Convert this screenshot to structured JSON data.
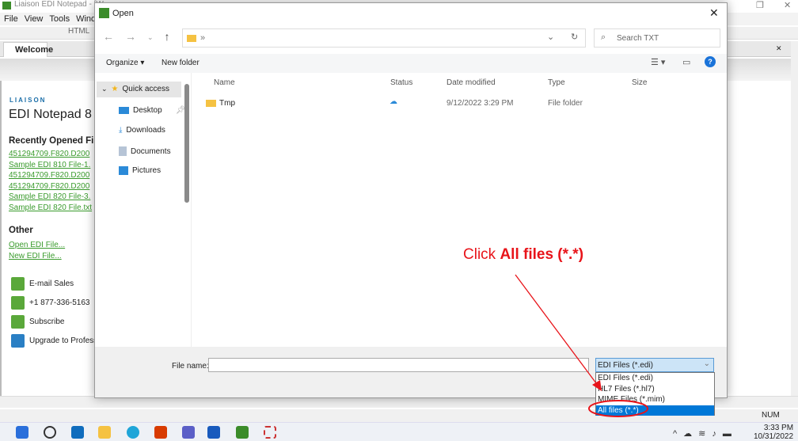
{
  "app": {
    "title": "Liaison EDI Notepad - [W...",
    "menu": [
      "File",
      "View",
      "Tools",
      "Window"
    ],
    "toolbar_mode": "HTML",
    "tab": "Welcome",
    "brand": "LIAISON",
    "product": "EDI Notepad 8",
    "recent_heading": "Recently Opened Files",
    "recent": [
      "451294709.F820.D200",
      "Sample EDI 810 File-1.",
      "451294709.F820.D200",
      "451294709.F820.D200",
      "Sample EDI 820 File-3.",
      "Sample EDI 820 File.txt"
    ],
    "other_heading": "Other",
    "other": [
      "Open EDI File...",
      "New EDI File..."
    ],
    "contacts": [
      "E-mail Sales",
      "+1 877-336-5163",
      "Subscribe",
      "Upgrade to Profess"
    ],
    "status_num": "NUM"
  },
  "dialog": {
    "title": "Open",
    "address": "»",
    "search_placeholder": "Search TXT",
    "organize": "Organize ▾",
    "new_folder": "New folder",
    "nav": [
      {
        "label": "Quick access"
      },
      {
        "label": "Desktop"
      },
      {
        "label": "Downloads"
      },
      {
        "label": "Documents"
      },
      {
        "label": "Pictures"
      }
    ],
    "columns": [
      "Name",
      "Status",
      "Date modified",
      "Type",
      "Size"
    ],
    "files": [
      {
        "name": "Tmp",
        "status": "cloud",
        "date": "9/12/2022 3:29 PM",
        "type": "File folder",
        "size": ""
      }
    ],
    "filename_label": "File name:",
    "filename_value": "",
    "filter_selected": "EDI Files (*.edi)",
    "filter_options": [
      "EDI Files (*.edi)",
      "HL7 Files (*.hl7)",
      "MIME Files (*.mim)",
      "All files (*.*)"
    ]
  },
  "annotation": {
    "prefix": "Click ",
    "bold": "All files (*.*)",
    "color": "#e8141a"
  },
  "taskbar": {
    "time": "3:33 PM",
    "date": "10/31/2022"
  }
}
